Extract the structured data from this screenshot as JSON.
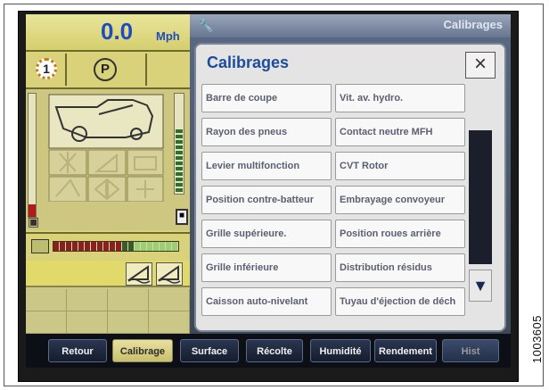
{
  "speed": {
    "value": "0.0",
    "unit": "Mph"
  },
  "status": {
    "gear": "1",
    "park": "P"
  },
  "header": {
    "strip_title": "Calibrages"
  },
  "dialog": {
    "title": "Calibrages",
    "close_label": "×",
    "left_column": [
      "Barre de coupe",
      "Rayon des pneus",
      "Levier multifonction",
      "Position contre-batteur",
      "Grille supérieure.",
      "Grille inférieure",
      "Caisson auto-nivelant"
    ],
    "right_column": [
      "Vit. av. hydro.",
      "Contact neutre MFH",
      "CVT Rotor",
      "Embrayage convoyeur",
      "Position roues arrière",
      "Distribution résidus",
      "Tuyau d'éjection de déch"
    ]
  },
  "bottom_tabs": [
    {
      "label": "Retour"
    },
    {
      "label": "Calibrage"
    },
    {
      "label": "Surface"
    },
    {
      "label": "Récolte"
    },
    {
      "label": "Humidité"
    },
    {
      "label": "Rendement"
    },
    {
      "label": "Hist"
    }
  ],
  "figure_number": "1003605"
}
